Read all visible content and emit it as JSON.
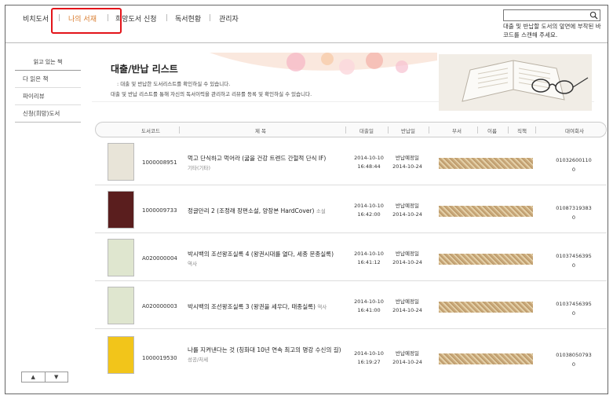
{
  "nav": {
    "items": [
      {
        "label": "비치도서",
        "active": false
      },
      {
        "label": "나의 서재",
        "active": true
      },
      {
        "label": "희망도서 신청",
        "active": false
      },
      {
        "label": "독서현황",
        "active": false
      },
      {
        "label": "관리자",
        "active": false
      }
    ],
    "search_hint": "대출 및 반납할 도서의 앞면에 부착된 바코드를 스캔해 주세요."
  },
  "sidebar": {
    "title": "읽고 있는 책",
    "items": [
      "다 읽은 책",
      "파이리뷰",
      "신청(희망)도서"
    ],
    "scroll_up": "▲",
    "scroll_down": "▼"
  },
  "header": {
    "title": "대출/반납 리스트",
    "desc1": ": 대출 및 반납한 도서리스트를 확인하실 수 있습니다.",
    "desc2": "대출 및 반납 리스트를 통해 자신의 독서이력을 관리하고 리뷰를 등록 및 확인하실 수 있습니다."
  },
  "table": {
    "columns": [
      "도서코드",
      "제 목",
      "대출일",
      "반납일",
      "부서",
      "이름",
      "직책",
      "대여회사"
    ],
    "rows": [
      {
        "code": "1000008951",
        "title": "먹고 단식하고 먹어라 (굶을 건강 트렌드 간헐적 단식 IF)",
        "genre": "기타(기타)",
        "loan_date": "2014-10-10",
        "loan_time": "16:48:44",
        "due_label": "반납예정일",
        "due_date": "2014-10-24",
        "phone": "01032600110",
        "phone2": "0",
        "cover_color": "#e8e4d8"
      },
      {
        "code": "1000009733",
        "title": "정글만리 2 (조정래 장편소설, 양장본 HardCover)",
        "genre": "소설",
        "loan_date": "2014-10-10",
        "loan_time": "16:42:00",
        "due_label": "반납예정일",
        "due_date": "2014-10-24",
        "phone": "01087319383",
        "phone2": "0",
        "cover_color": "#5a1e1e"
      },
      {
        "code": "A020000004",
        "title": "박시백의 조선왕조실록 4 (왕권시대를 열다, 세종 문종실록)",
        "genre": "역사",
        "loan_date": "2014-10-10",
        "loan_time": "16:41:12",
        "due_label": "반납예정일",
        "due_date": "2014-10-24",
        "phone": "01037456395",
        "phone2": "0",
        "cover_color": "#dfe6cf"
      },
      {
        "code": "A020000003",
        "title": "박시백의 조선왕조실록 3 (왕권을 세우다, 태종실록)",
        "genre": "역사",
        "loan_date": "2014-10-10",
        "loan_time": "16:41:00",
        "due_label": "반납예정일",
        "due_date": "2014-10-24",
        "phone": "01037456395",
        "phone2": "0",
        "cover_color": "#dfe6cf"
      },
      {
        "code": "1000019530",
        "title": "나를 지켜낸다는 것 (칭화대 10년 연속 최고의 명강 수신의 길)",
        "genre": "성공/처세",
        "loan_date": "2014-10-10",
        "loan_time": "16:19:27",
        "due_label": "반납예정일",
        "due_date": "2014-10-24",
        "phone": "01038050793",
        "phone2": "0",
        "cover_color": "#f2c51a"
      }
    ]
  }
}
